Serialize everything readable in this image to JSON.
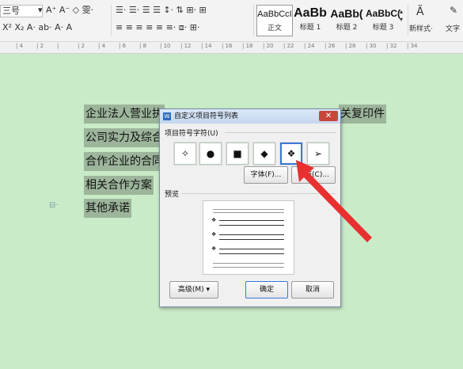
{
  "ribbon": {
    "font_size": "三号",
    "font_size_dd": "▾",
    "row1_tools": "A⁺ A⁻ ◇ 雯·",
    "row2_tools": "X² X₂ A·  ab·  A·  A",
    "para_row1": "☰·  ☰·  ☰  ☰  ↕·  ⇅  ⊞·  ⊞",
    "para_row2": "≡  ≡  ≡  ≡  ≡  ≡·  ⧈·  ⊞·",
    "styles": [
      {
        "preview": "AaBbCcI",
        "label": "正文"
      },
      {
        "preview": "AaBb",
        "label": "标题 1"
      },
      {
        "preview": "AaBb(",
        "label": "标题 2"
      },
      {
        "preview": "AaBbC(",
        "label": "标题 3"
      }
    ],
    "new_style": "新样式·",
    "text_tool": "文字"
  },
  "ruler": {
    "ticks": [
      "4",
      "2",
      "",
      "2",
      "4",
      "6",
      "8",
      "10",
      "12",
      "14",
      "16",
      "18",
      "20",
      "22",
      "24",
      "26",
      "28",
      "30",
      "32",
      "34"
    ]
  },
  "document": {
    "lines": [
      "企业法人营业执",
      "公司实力及综合",
      "合作企业的合同",
      "相关合作方案",
      "其他承诺"
    ],
    "right_fragment": "关复印件",
    "margin_marker": "⊟·"
  },
  "dialog": {
    "icon": "W",
    "title": "自定义项目符号列表",
    "close": "✕",
    "group_label": "项目符号字符(U)",
    "symbols": [
      "✧",
      "●",
      "■",
      "◆",
      "❖",
      "➢"
    ],
    "selected_index": 4,
    "font_button": "字体(F)...",
    "char_button": "字符(C)...",
    "preview_label": "预览",
    "preview_bullet": "❖",
    "advanced_button": "高级(M) ▾",
    "ok_button": "确定",
    "cancel_button": "取消"
  },
  "colors": {
    "page": "#c9ebc8",
    "highlight": "#9cb59b",
    "arrow": "#e83030",
    "selection": "#3a78d8"
  }
}
